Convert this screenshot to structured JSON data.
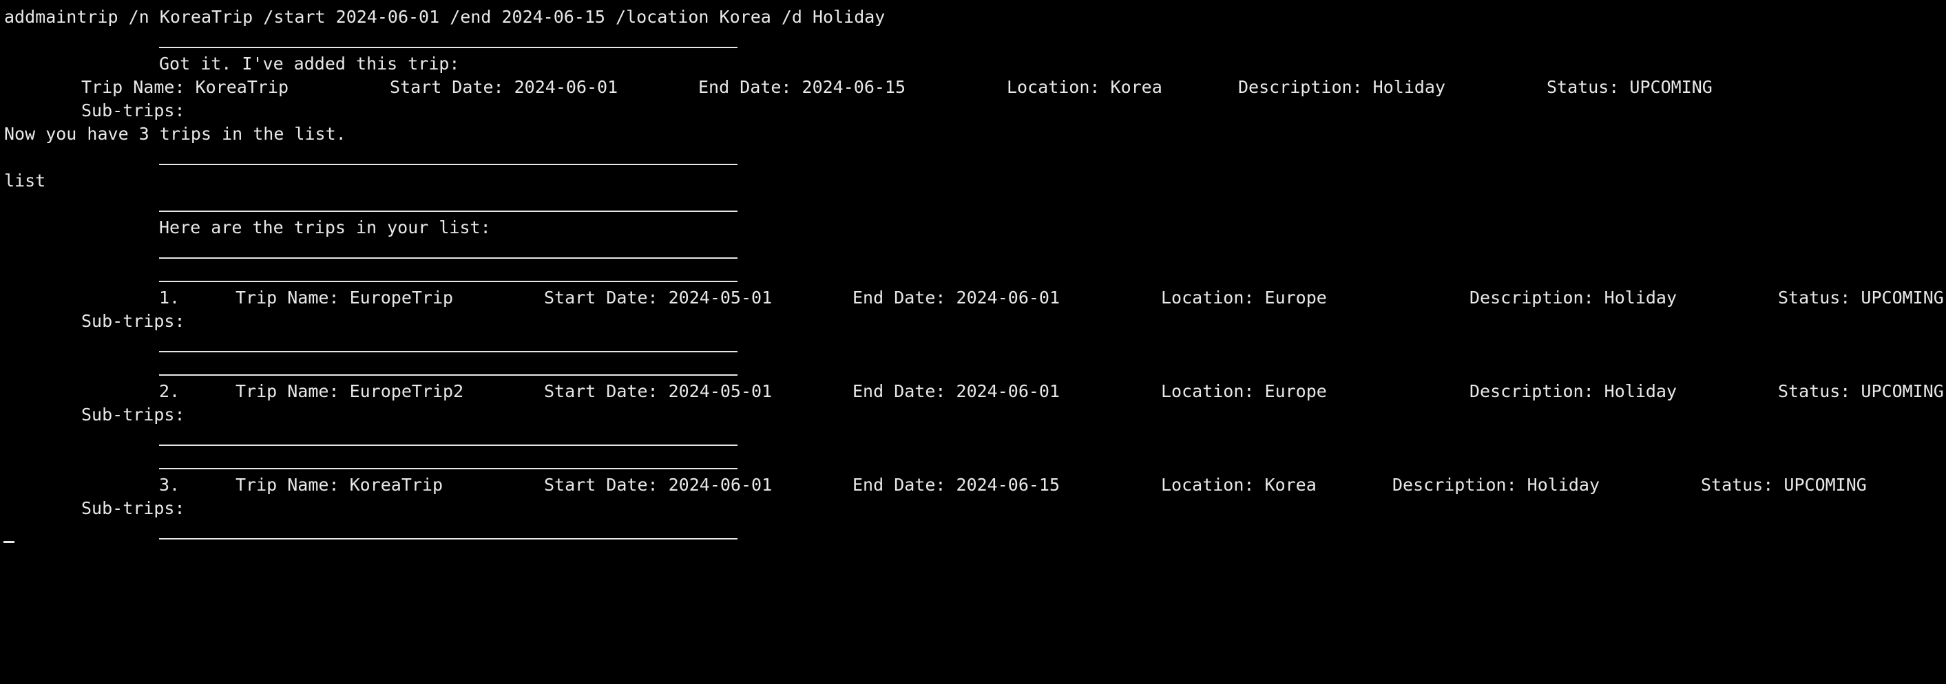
{
  "terminal": {
    "command_addmaintrip": "addmaintrip /n KoreaTrip /start 2024-06-01 /end 2024-06-15 /location Korea /d Holiday",
    "added_header": "Got it. I've added this trip:",
    "added_trip": {
      "name": "Trip Name: KoreaTrip",
      "start": "Start Date: 2024-06-01",
      "end": "End Date: 2024-06-15",
      "location": "Location: Korea",
      "description": "Description: Holiday",
      "status": "Status: UPCOMING"
    },
    "subtrips_label": "Sub-trips:",
    "count_message": "Now you have 3 trips in the list.",
    "command_list": "list",
    "list_header": "Here are the trips in your list:",
    "trips": [
      {
        "index": "1.",
        "name": "Trip Name: EuropeTrip",
        "start": "Start Date: 2024-05-01",
        "end": "End Date: 2024-06-01",
        "location": "Location: Europe",
        "description": "Description: Holiday",
        "status": "Status: UPCOMING"
      },
      {
        "index": "2.",
        "name": "Trip Name: EuropeTrip2",
        "start": "Start Date: 2024-05-01",
        "end": "End Date: 2024-06-01",
        "location": "Location: Europe",
        "description": "Description: Holiday",
        "status": "Status: UPCOMING"
      },
      {
        "index": "3.",
        "name": "Trip Name: KoreaTrip",
        "start": "Start Date: 2024-06-01",
        "end": "End Date: 2024-06-15",
        "location": "Location: Korea",
        "description": "Description: Holiday",
        "status": "Status: UPCOMING"
      }
    ]
  }
}
